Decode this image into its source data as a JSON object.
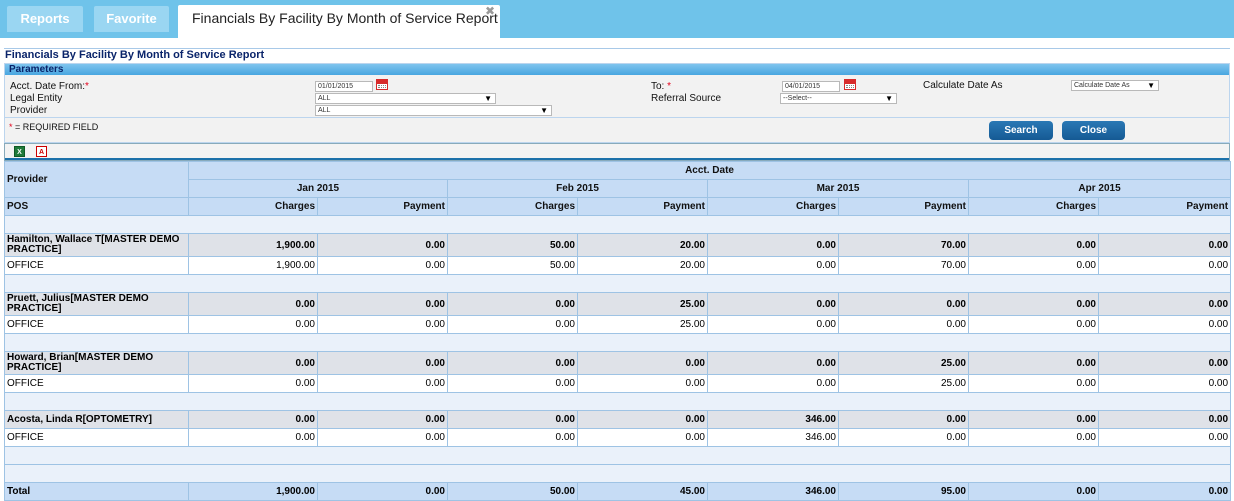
{
  "tabs": {
    "reports": "Reports",
    "favorite": "Favorite",
    "active": "Financials By Facility By Month of Service Report",
    "close_glyph": "✖"
  },
  "report_title": "Financials By Facility By Month of Service Report",
  "parameters": {
    "header": "Parameters",
    "acct_date_from_label": "Acct. Date From:",
    "acct_date_from_value": "01/01/2015",
    "to_label": "To:",
    "to_value": "04/01/2015",
    "calculate_date_as_label": "Calculate Date As",
    "calculate_date_as_value": "Calculate Date As",
    "legal_entity_label": "Legal Entity",
    "legal_entity_value": "ALL",
    "referral_source_label": "Referral Source",
    "referral_source_value": "--Select--",
    "provider_label": "Provider",
    "provider_value": "ALL",
    "required_star": "*",
    "required_note": "= REQUIRED FIELD",
    "search_button": "Search",
    "close_button": "Close"
  },
  "export": {
    "excel_icon": "excel-icon",
    "pdf_icon": "pdf-icon",
    "excel_glyph": "X",
    "pdf_glyph": "A"
  },
  "table": {
    "provider_header": "Provider",
    "acct_date_header": "Acct. Date",
    "pos_header": "POS",
    "months": [
      "Jan 2015",
      "Feb 2015",
      "Mar 2015",
      "Apr 2015"
    ],
    "charges_label": "Charges",
    "payment_label": "Payment",
    "groups": [
      {
        "name": "Hamilton, Wallace T[MASTER DEMO PRACTICE]",
        "values": [
          "1,900.00",
          "0.00",
          "50.00",
          "20.00",
          "0.00",
          "70.00",
          "0.00",
          "0.00"
        ],
        "detail_name": "OFFICE",
        "detail_values": [
          "1,900.00",
          "0.00",
          "50.00",
          "20.00",
          "0.00",
          "70.00",
          "0.00",
          "0.00"
        ]
      },
      {
        "name": "Pruett, Julius[MASTER DEMO PRACTICE]",
        "values": [
          "0.00",
          "0.00",
          "0.00",
          "25.00",
          "0.00",
          "0.00",
          "0.00",
          "0.00"
        ],
        "detail_name": "OFFICE",
        "detail_values": [
          "0.00",
          "0.00",
          "0.00",
          "25.00",
          "0.00",
          "0.00",
          "0.00",
          "0.00"
        ]
      },
      {
        "name": "Howard, Brian[MASTER DEMO PRACTICE]",
        "values": [
          "0.00",
          "0.00",
          "0.00",
          "0.00",
          "0.00",
          "25.00",
          "0.00",
          "0.00"
        ],
        "detail_name": "OFFICE",
        "detail_values": [
          "0.00",
          "0.00",
          "0.00",
          "0.00",
          "0.00",
          "25.00",
          "0.00",
          "0.00"
        ]
      },
      {
        "name": "Acosta, Linda R[OPTOMETRY]",
        "values": [
          "0.00",
          "0.00",
          "0.00",
          "0.00",
          "346.00",
          "0.00",
          "0.00",
          "0.00"
        ],
        "detail_name": "OFFICE",
        "detail_values": [
          "0.00",
          "0.00",
          "0.00",
          "0.00",
          "346.00",
          "0.00",
          "0.00",
          "0.00"
        ]
      }
    ],
    "total_label": "Total",
    "total_values": [
      "1,900.00",
      "0.00",
      "50.00",
      "45.00",
      "346.00",
      "95.00",
      "0.00",
      "0.00"
    ]
  }
}
